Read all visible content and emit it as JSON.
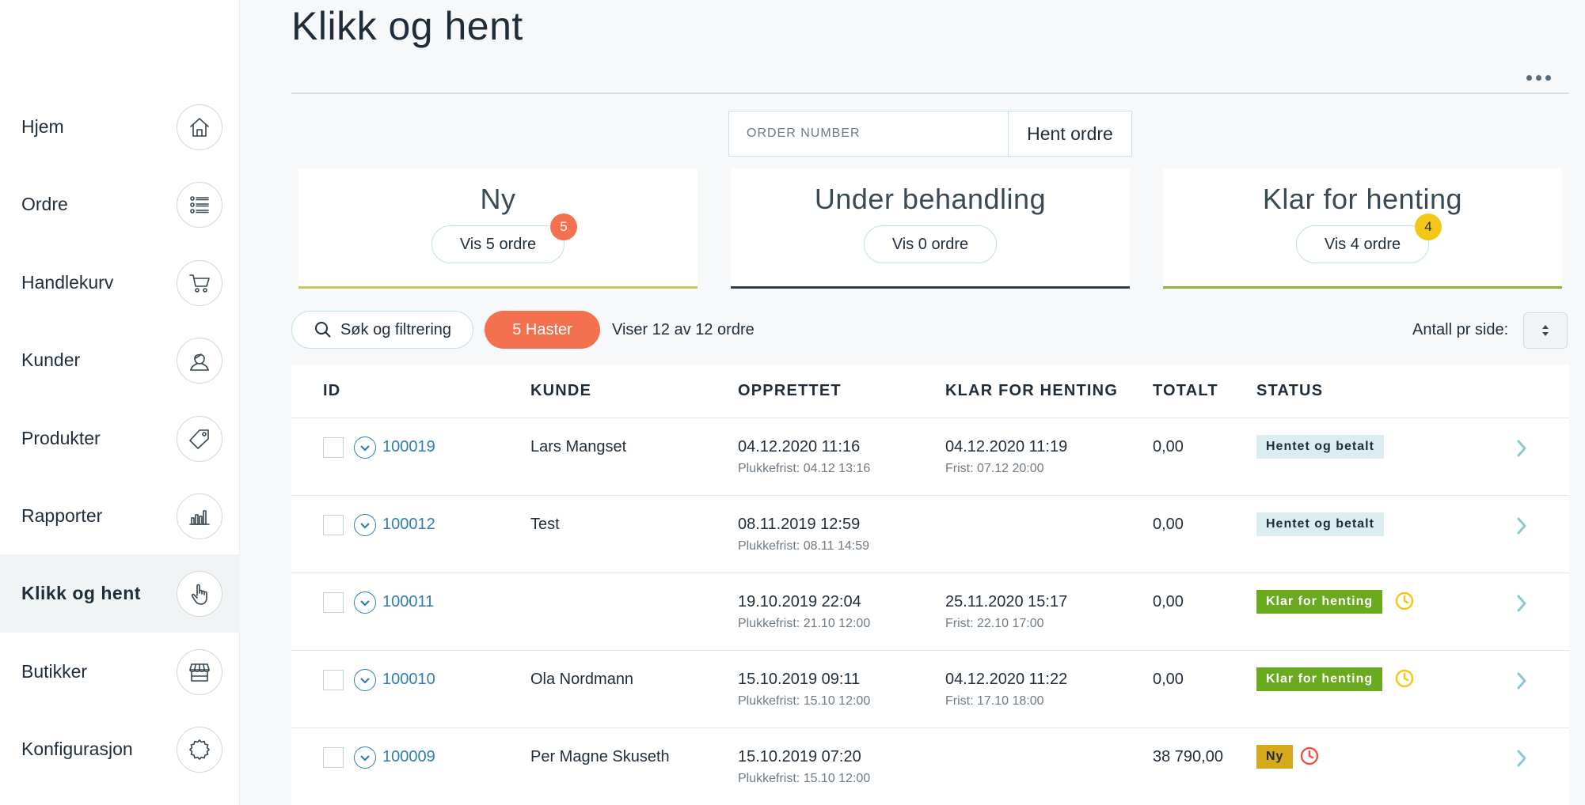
{
  "sidebar": {
    "items": [
      {
        "label": "Hjem",
        "icon": "home-icon"
      },
      {
        "label": "Ordre",
        "icon": "list-icon"
      },
      {
        "label": "Handlekurv",
        "icon": "cart-icon"
      },
      {
        "label": "Kunder",
        "icon": "user-icon"
      },
      {
        "label": "Produkter",
        "icon": "tag-icon"
      },
      {
        "label": "Rapporter",
        "icon": "bar-chart-icon"
      },
      {
        "label": "Klikk og hent",
        "icon": "pointer-hand-icon",
        "active": true
      },
      {
        "label": "Butikker",
        "icon": "store-icon"
      },
      {
        "label": "Konfigurasjon",
        "icon": "gear-icon"
      }
    ]
  },
  "header": {
    "title": "Klikk og hent"
  },
  "order_search": {
    "placeholder": "ORDER NUMBER",
    "button_label": "Hent ordre"
  },
  "cards": [
    {
      "title": "Ny",
      "button_label": "Vis 5 ordre",
      "badge": "5",
      "badge_color": "#f47150",
      "line_color": "#c9c65a"
    },
    {
      "title": "Under behandling",
      "button_label": "Vis 0 ordre",
      "badge": "",
      "line_color": "#2d3e4a"
    },
    {
      "title": "Klar for henting",
      "button_label": "Vis 4 ordre",
      "badge": "4",
      "badge_color": "#f5c518",
      "line_color": "#8fb33a"
    }
  ],
  "filters": {
    "search_label": "Søk og filtrering",
    "urgent_label": "5 Haster",
    "showing_text": "Viser 12 av 12 ordre",
    "per_page_label": "Antall pr side:"
  },
  "table": {
    "columns": [
      "ID",
      "KUNDE",
      "OPPRETTET",
      "KLAR FOR HENTING",
      "TOTALT",
      "STATUS"
    ],
    "rows": [
      {
        "id": "100019",
        "customer": "Lars Mangset",
        "created": "04.12.2020 11:16",
        "created_sub": "Plukkefrist: 04.12 13:16",
        "ready": "04.12.2020 11:19",
        "ready_sub": "Frist: 07.12 20:00",
        "total": "0,00",
        "status": "Hentet og betalt",
        "status_type": "done",
        "clock": ""
      },
      {
        "id": "100012",
        "customer": "Test",
        "created": "08.11.2019 12:59",
        "created_sub": "Plukkefrist: 08.11 14:59",
        "ready": "",
        "ready_sub": "",
        "total": "0,00",
        "status": "Hentet og betalt",
        "status_type": "done",
        "clock": ""
      },
      {
        "id": "100011",
        "customer": "",
        "created": "19.10.2019 22:04",
        "created_sub": "Plukkefrist: 21.10 12:00",
        "ready": "25.11.2020 15:17",
        "ready_sub": "Frist: 22.10 17:00",
        "total": "0,00",
        "status": "Klar for henting",
        "status_type": "ready",
        "clock": "yellow"
      },
      {
        "id": "100010",
        "customer": "Ola Nordmann",
        "created": "15.10.2019 09:11",
        "created_sub": "Plukkefrist: 15.10 12:00",
        "ready": "04.12.2020 11:22",
        "ready_sub": "Frist: 17.10 18:00",
        "total": "0,00",
        "status": "Klar for henting",
        "status_type": "ready",
        "clock": "yellow"
      },
      {
        "id": "100009",
        "customer": "Per Magne Skuseth",
        "created": "15.10.2019 07:20",
        "created_sub": "Plukkefrist: 15.10 12:00",
        "ready": "",
        "ready_sub": "",
        "total": "38 790,00",
        "status": "Ny",
        "status_type": "new",
        "clock": "red"
      }
    ]
  },
  "colors": {
    "accent_orange": "#f47150",
    "link_blue": "#2e7fb0",
    "status_done_bg": "#dcedf1",
    "status_ready_bg": "#6aaa1f",
    "status_new_bg": "#d7aa1c",
    "clock_yellow": "#f5c518",
    "clock_red": "#e9553f"
  }
}
